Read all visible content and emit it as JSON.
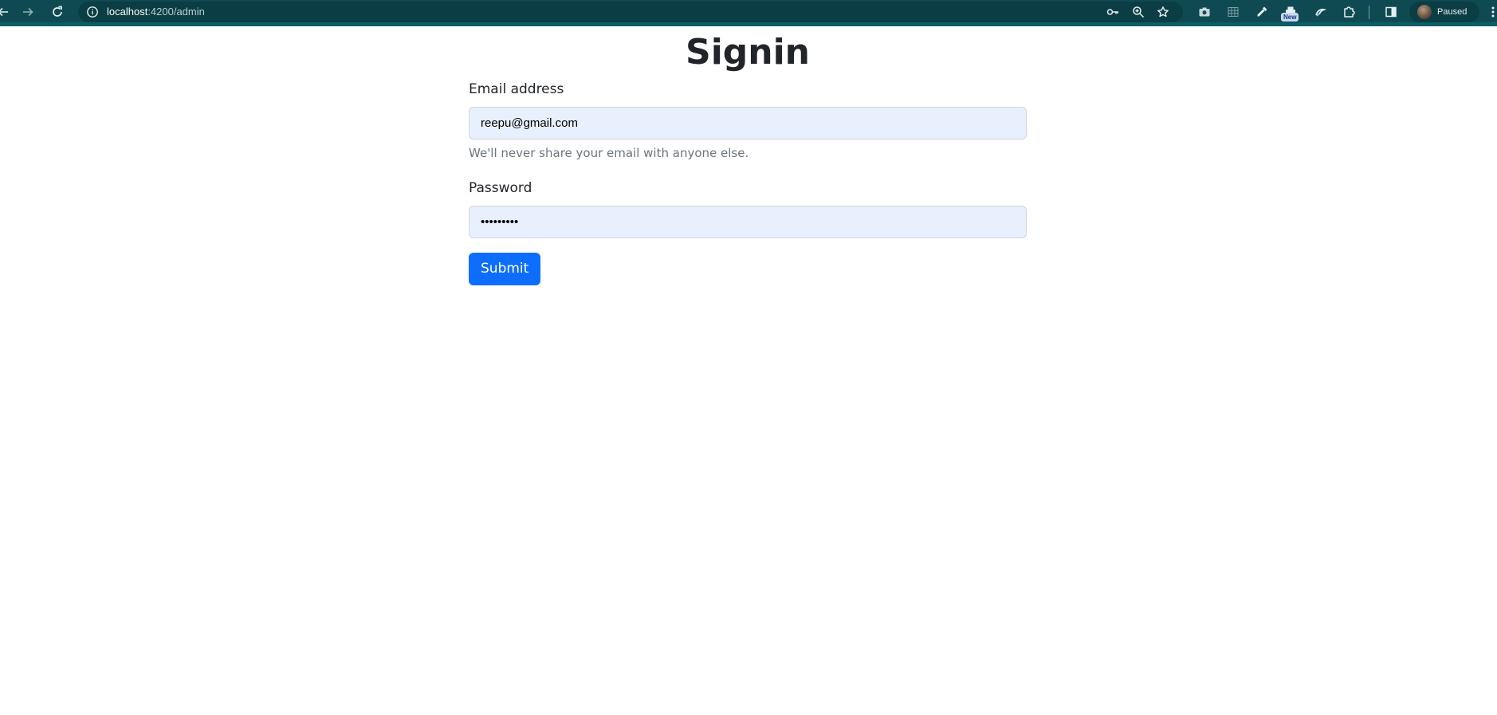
{
  "browser": {
    "url_host": "localhost",
    "url_path": ":4200/admin",
    "new_badge": "New",
    "profile_status": "Paused",
    "icons": {
      "back": "back-arrow-icon",
      "forward": "forward-arrow-icon",
      "reload": "reload-icon",
      "site_info": "info-icon",
      "passwords": "key-icon",
      "zoom": "zoom-icon",
      "bookmark": "star-icon",
      "screenshot": "camera-icon",
      "extension_grid": "grid-icon",
      "eyedropper": "eyedropper-icon",
      "new_extension": "printer-icon",
      "extension_puzzle_alt": "swirl-icon",
      "extensions": "puzzle-icon",
      "side_panel": "side-panel-icon",
      "menu": "more-vert-icon"
    },
    "colors": {
      "toolbar": "#0f4a52",
      "omnibox": "#0b3d44"
    }
  },
  "page": {
    "title": "Signin",
    "email_label": "Email address",
    "email_value": "reepu@gmail.com",
    "email_help": "We'll never share your email with anyone else.",
    "password_label": "Password",
    "password_value": "•••••••••",
    "submit_label": "Submit",
    "colors": {
      "primary": "#0d6efd",
      "autofill_bg": "#e8f0fe",
      "text": "#212529",
      "muted": "#6c757d"
    }
  }
}
